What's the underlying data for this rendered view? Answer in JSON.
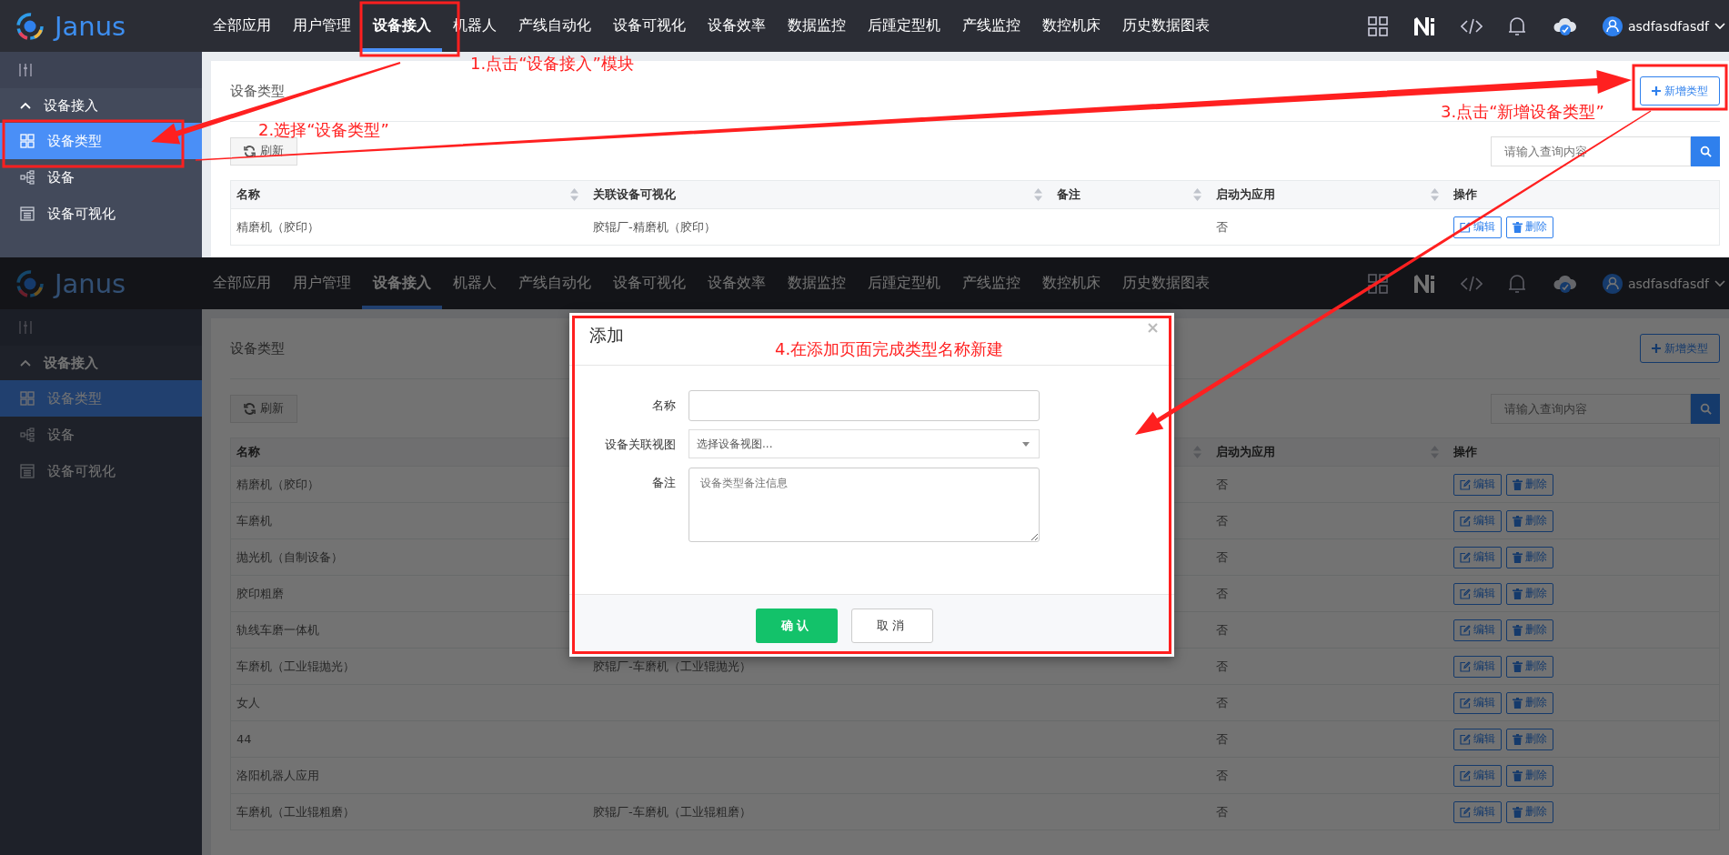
{
  "screens": [
    {
      "logo": "Janus",
      "nav": [
        {
          "label": "全部应用",
          "selected": false
        },
        {
          "label": "用户管理",
          "selected": false
        },
        {
          "label": "设备接入",
          "selected": true
        },
        {
          "label": "机器人",
          "selected": false
        },
        {
          "label": "产线自动化",
          "selected": false
        },
        {
          "label": "设备可视化",
          "selected": false
        },
        {
          "label": "设备效率",
          "selected": false
        },
        {
          "label": "数据监控",
          "selected": false
        },
        {
          "label": "后踵定型机",
          "selected": false
        },
        {
          "label": "产线监控",
          "selected": false
        },
        {
          "label": "数控机床",
          "selected": false
        },
        {
          "label": "历史数据图表",
          "selected": false
        }
      ],
      "user": "asdfasdfasdf",
      "sidebar": {
        "group": "设备接入",
        "expanded": true,
        "items": [
          {
            "label": "设备类型",
            "kind": "grid",
            "selected": true
          },
          {
            "label": "设备",
            "kind": "tree",
            "selected": false
          },
          {
            "label": "设备可视化",
            "kind": "page",
            "selected": false
          }
        ]
      },
      "title": "设备类型",
      "add_button": "新增类型",
      "refresh_button": "刷新",
      "search": {
        "placeholder": "请输入查询内容"
      },
      "columns": [
        {
          "label": "名称",
          "sortable": true
        },
        {
          "label": "关联设备可视化",
          "sortable": true
        },
        {
          "label": "备注",
          "sortable": true
        },
        {
          "label": "启动为应用",
          "sortable": true
        },
        {
          "label": "操作",
          "sortable": false
        }
      ],
      "rows": [
        {
          "name": "精磨机（胶印）",
          "view": "胶辊厂-精磨机（胶印）",
          "app": "否",
          "actions": [
            "编辑",
            "删除"
          ]
        }
      ],
      "dimmed": false
    },
    {
      "logo": "Janus",
      "nav": [
        {
          "label": "全部应用",
          "selected": false
        },
        {
          "label": "用户管理",
          "selected": false
        },
        {
          "label": "设备接入",
          "selected": true
        },
        {
          "label": "机器人",
          "selected": false
        },
        {
          "label": "产线自动化",
          "selected": false
        },
        {
          "label": "设备可视化",
          "selected": false
        },
        {
          "label": "设备效率",
          "selected": false
        },
        {
          "label": "数据监控",
          "selected": false
        },
        {
          "label": "后踵定型机",
          "selected": false
        },
        {
          "label": "产线监控",
          "selected": false
        },
        {
          "label": "数控机床",
          "selected": false
        },
        {
          "label": "历史数据图表",
          "selected": false
        }
      ],
      "user": "asdfasdfasdf",
      "sidebar": {
        "group": "设备接入",
        "expanded": true,
        "items": [
          {
            "label": "设备类型",
            "kind": "grid",
            "selected": true
          },
          {
            "label": "设备",
            "kind": "tree",
            "selected": false
          },
          {
            "label": "设备可视化",
            "kind": "page",
            "selected": false
          }
        ]
      },
      "title": "设备类型",
      "add_button": "新增类型",
      "refresh_button": "刷新",
      "search": {
        "placeholder": "请输入查询内容"
      },
      "columns": [
        {
          "label": "名称",
          "sortable": false
        },
        {},
        {
          "sortable": true
        },
        {
          "label": "启动为应用",
          "sortable": true
        },
        {
          "label": "操作",
          "sortable": false
        }
      ],
      "rows": [
        {
          "name": "精磨机（胶印）",
          "app": "否",
          "actions": [
            "编辑",
            "删除"
          ]
        },
        {
          "name": "车磨机",
          "app": "否",
          "actions": [
            "编辑",
            "删除"
          ]
        },
        {
          "name": "抛光机（自制设备）",
          "app": "否",
          "actions": [
            "编辑",
            "删除"
          ]
        },
        {
          "name": "胶印粗磨",
          "app": "否",
          "actions": [
            "编辑",
            "删除"
          ]
        },
        {
          "name": "轨线车磨一体机",
          "app": "否",
          "actions": [
            "编辑",
            "删除"
          ]
        },
        {
          "name": "车磨机（工业辊抛光）",
          "view": "胶辊厂-车磨机（工业辊抛光）",
          "app": "否",
          "actions": [
            "编辑",
            "删除"
          ]
        },
        {
          "name": "女人",
          "app": "否",
          "actions": [
            "编辑",
            "删除"
          ]
        },
        {
          "name": "44",
          "app": "否",
          "actions": [
            "编辑",
            "删除"
          ]
        },
        {
          "name": "洛阳机器人应用",
          "app": "否",
          "actions": [
            "编辑",
            "删除"
          ]
        },
        {
          "name": "车磨机（工业辊粗磨）",
          "view": "胶辊厂-车磨机（工业辊粗磨）",
          "app": "否",
          "actions": [
            "编辑",
            "删除"
          ]
        }
      ],
      "dimmed": true,
      "dialog": {
        "title": "添加",
        "fields": [
          {
            "kind": "text",
            "label": "名称"
          },
          {
            "kind": "select",
            "label": "设备关联视图",
            "placeholder": "选择设备视图..."
          },
          {
            "kind": "textarea",
            "label": "备注",
            "placeholder": "设备类型备注信息"
          }
        ],
        "buttons": [
          {
            "label": "确认",
            "kind": "primary"
          },
          {
            "label": "取消",
            "kind": "default"
          }
        ]
      }
    }
  ],
  "annotations": [
    {
      "text": "1.点击“设备接入”模块"
    },
    {
      "text": "2.选择“设备类型”"
    },
    {
      "text": "3.点击“新增设备类型”"
    },
    {
      "text": "4.在添加页面完成类型名称新建"
    }
  ]
}
